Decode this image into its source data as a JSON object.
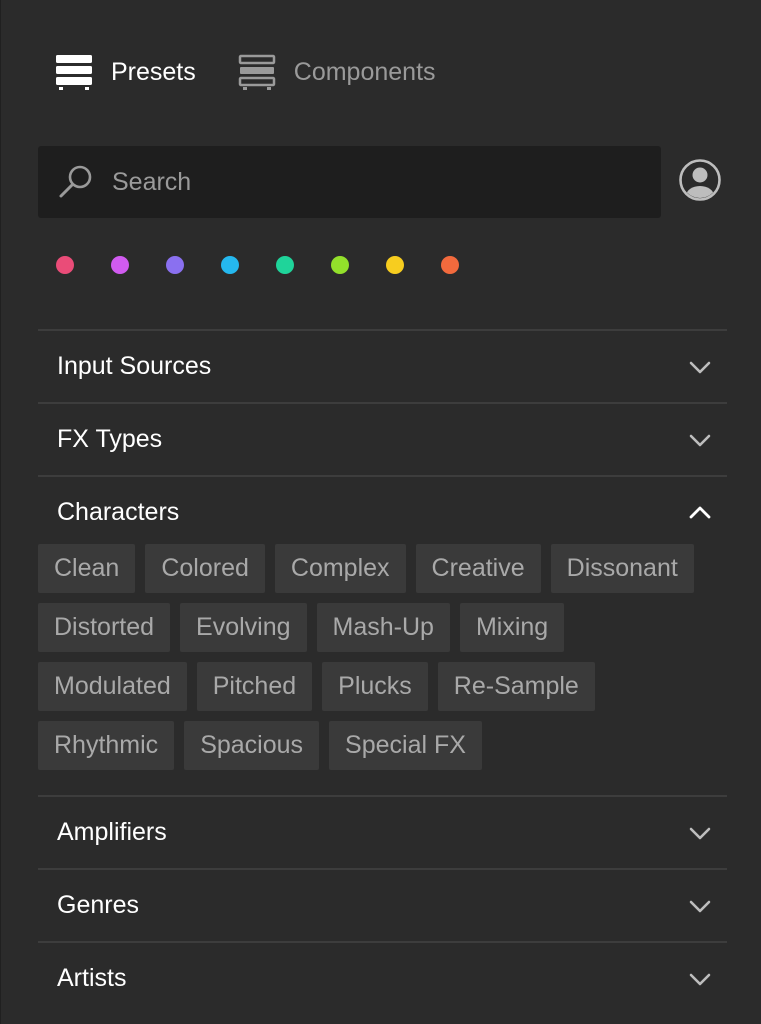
{
  "tabs": [
    {
      "label": "Presets",
      "icon": "presets-icon",
      "active": true
    },
    {
      "label": "Components",
      "icon": "components-icon",
      "active": false
    }
  ],
  "search": {
    "placeholder": "Search",
    "value": ""
  },
  "color_filters": [
    "#ea4c78",
    "#d15bf0",
    "#8a70f0",
    "#25b8ef",
    "#1fd49a",
    "#93e02b",
    "#f7cd1f",
    "#f26a3d"
  ],
  "sections": {
    "input_sources": {
      "title": "Input Sources",
      "expanded": false
    },
    "fx_types": {
      "title": "FX Types",
      "expanded": false
    },
    "characters": {
      "title": "Characters",
      "expanded": true,
      "tags": [
        "Clean",
        "Colored",
        "Complex",
        "Creative",
        "Dissonant",
        "Distorted",
        "Evolving",
        "Mash-Up",
        "Mixing",
        "Modulated",
        "Pitched",
        "Plucks",
        "Re-Sample",
        "Rhythmic",
        "Spacious",
        "Special FX"
      ]
    },
    "amplifiers": {
      "title": "Amplifiers",
      "expanded": false
    },
    "genres": {
      "title": "Genres",
      "expanded": false
    },
    "artists": {
      "title": "Artists",
      "expanded": false
    }
  }
}
